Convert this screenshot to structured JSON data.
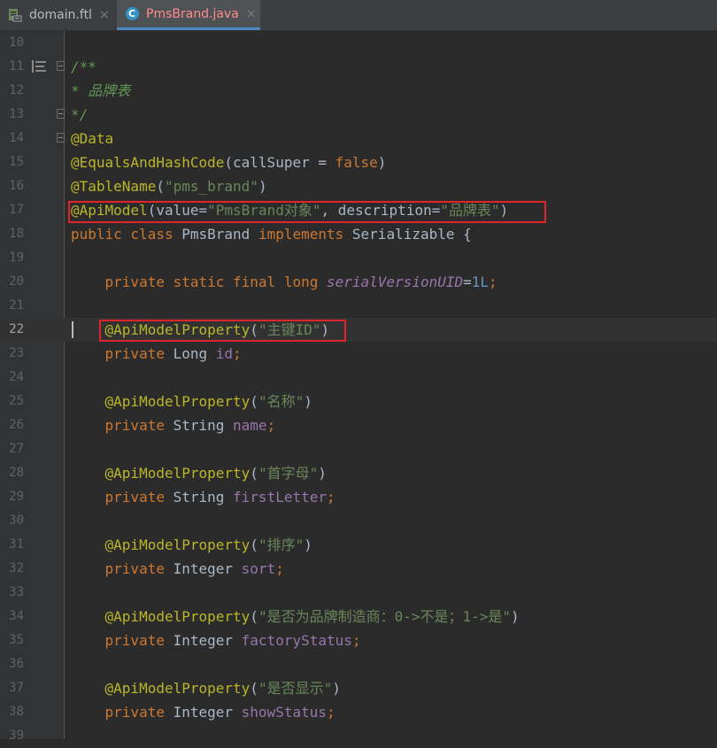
{
  "tabs": [
    {
      "label": "domain.ftl",
      "icon": "freemarker-file-icon",
      "active": false
    },
    {
      "label": "PmsBrand.java",
      "icon": "java-class-icon",
      "active": true
    }
  ],
  "tab_close_glyph": "×",
  "class_icon_letter": "C",
  "lines": [
    {
      "n": "10",
      "tokens": []
    },
    {
      "n": "11",
      "tokens": [
        {
          "t": "/**",
          "c": "cm"
        }
      ]
    },
    {
      "n": "12",
      "tokens": [
        {
          "t": "* 品牌表",
          "c": "cm"
        }
      ]
    },
    {
      "n": "13",
      "tokens": [
        {
          "t": "*/",
          "c": "cm"
        }
      ]
    },
    {
      "n": "14",
      "tokens": [
        {
          "t": "@Data",
          "c": "an"
        }
      ]
    },
    {
      "n": "15",
      "tokens": [
        {
          "t": "@EqualsAndHashCode",
          "c": "an"
        },
        {
          "t": "(callSuper = ",
          "c": ""
        },
        {
          "t": "false",
          "c": "kw"
        },
        {
          "t": ")",
          "c": ""
        }
      ]
    },
    {
      "n": "16",
      "tokens": [
        {
          "t": "@TableName",
          "c": "an"
        },
        {
          "t": "(",
          "c": ""
        },
        {
          "t": "\"pms_brand\"",
          "c": "st"
        },
        {
          "t": ")",
          "c": ""
        }
      ]
    },
    {
      "n": "17",
      "tokens": [
        {
          "t": "@ApiModel",
          "c": "an"
        },
        {
          "t": "(value=",
          "c": ""
        },
        {
          "t": "\"PmsBrand对象\"",
          "c": "st"
        },
        {
          "t": ", description=",
          "c": ""
        },
        {
          "t": "\"品牌表\"",
          "c": "st"
        },
        {
          "t": ")",
          "c": ""
        }
      ]
    },
    {
      "n": "18",
      "tokens": [
        {
          "t": "public class ",
          "c": "kw"
        },
        {
          "t": "PmsBrand ",
          "c": ""
        },
        {
          "t": "implements ",
          "c": "kw"
        },
        {
          "t": "Serializable {",
          "c": ""
        }
      ]
    },
    {
      "n": "19",
      "tokens": []
    },
    {
      "n": "20",
      "tokens": [
        {
          "t": "    private static final long ",
          "c": "kw"
        },
        {
          "t": "serialVersionUID",
          "c": "sf"
        },
        {
          "t": "=",
          "c": ""
        },
        {
          "t": "1L",
          "c": "nm"
        },
        {
          "t": ";",
          "c": "kw"
        }
      ]
    },
    {
      "n": "21",
      "tokens": []
    },
    {
      "n": "22",
      "tokens": [
        {
          "t": "    ",
          "c": ""
        },
        {
          "t": "@ApiModelProperty",
          "c": "an"
        },
        {
          "t": "(",
          "c": ""
        },
        {
          "t": "\"主键ID\"",
          "c": "st"
        },
        {
          "t": ")",
          "c": ""
        }
      ]
    },
    {
      "n": "23",
      "tokens": [
        {
          "t": "    private ",
          "c": "kw"
        },
        {
          "t": "Long ",
          "c": ""
        },
        {
          "t": "id",
          "c": "fd"
        },
        {
          "t": ";",
          "c": "kw"
        }
      ]
    },
    {
      "n": "24",
      "tokens": []
    },
    {
      "n": "25",
      "tokens": [
        {
          "t": "    ",
          "c": ""
        },
        {
          "t": "@ApiModelProperty",
          "c": "an"
        },
        {
          "t": "(",
          "c": ""
        },
        {
          "t": "\"名称\"",
          "c": "st"
        },
        {
          "t": ")",
          "c": ""
        }
      ]
    },
    {
      "n": "26",
      "tokens": [
        {
          "t": "    private ",
          "c": "kw"
        },
        {
          "t": "String ",
          "c": ""
        },
        {
          "t": "name",
          "c": "fd"
        },
        {
          "t": ";",
          "c": "kw"
        }
      ]
    },
    {
      "n": "27",
      "tokens": []
    },
    {
      "n": "28",
      "tokens": [
        {
          "t": "    ",
          "c": ""
        },
        {
          "t": "@ApiModelProperty",
          "c": "an"
        },
        {
          "t": "(",
          "c": ""
        },
        {
          "t": "\"首字母\"",
          "c": "st"
        },
        {
          "t": ")",
          "c": ""
        }
      ]
    },
    {
      "n": "29",
      "tokens": [
        {
          "t": "    private ",
          "c": "kw"
        },
        {
          "t": "String ",
          "c": ""
        },
        {
          "t": "firstLetter",
          "c": "fd"
        },
        {
          "t": ";",
          "c": "kw"
        }
      ]
    },
    {
      "n": "30",
      "tokens": []
    },
    {
      "n": "31",
      "tokens": [
        {
          "t": "    ",
          "c": ""
        },
        {
          "t": "@ApiModelProperty",
          "c": "an"
        },
        {
          "t": "(",
          "c": ""
        },
        {
          "t": "\"排序\"",
          "c": "st"
        },
        {
          "t": ")",
          "c": ""
        }
      ]
    },
    {
      "n": "32",
      "tokens": [
        {
          "t": "    private ",
          "c": "kw"
        },
        {
          "t": "Integer ",
          "c": ""
        },
        {
          "t": "sort",
          "c": "fd"
        },
        {
          "t": ";",
          "c": "kw"
        }
      ]
    },
    {
      "n": "33",
      "tokens": []
    },
    {
      "n": "34",
      "tokens": [
        {
          "t": "    ",
          "c": ""
        },
        {
          "t": "@ApiModelProperty",
          "c": "an"
        },
        {
          "t": "(",
          "c": ""
        },
        {
          "t": "\"是否为品牌制造商：0->不是；1->是\"",
          "c": "st"
        },
        {
          "t": ")",
          "c": ""
        }
      ]
    },
    {
      "n": "35",
      "tokens": [
        {
          "t": "    private ",
          "c": "kw"
        },
        {
          "t": "Integer ",
          "c": ""
        },
        {
          "t": "factoryStatus",
          "c": "fd"
        },
        {
          "t": ";",
          "c": "kw"
        }
      ]
    },
    {
      "n": "36",
      "tokens": []
    },
    {
      "n": "37",
      "tokens": [
        {
          "t": "    ",
          "c": ""
        },
        {
          "t": "@ApiModelProperty",
          "c": "an"
        },
        {
          "t": "(",
          "c": ""
        },
        {
          "t": "\"是否显示\"",
          "c": "st"
        },
        {
          "t": ")",
          "c": ""
        }
      ]
    },
    {
      "n": "38",
      "tokens": [
        {
          "t": "    private ",
          "c": "kw"
        },
        {
          "t": "Integer ",
          "c": ""
        },
        {
          "t": "showStatus",
          "c": "fd"
        },
        {
          "t": ";",
          "c": "kw"
        }
      ]
    },
    {
      "n": "39",
      "tokens": []
    }
  ],
  "current_line": "22",
  "highlighted_lines": [
    "17",
    "22"
  ],
  "fold_marker_lines": [
    "11",
    "13",
    "14"
  ],
  "bookmark_line": "11",
  "colors": {
    "background": "#2b2b2b",
    "keyword": "#cc7832",
    "annotation": "#bbb529",
    "string": "#6a8759",
    "comment": "#629755",
    "field": "#9876aa",
    "number": "#6897bb",
    "highlight_box": "#e0242b"
  }
}
